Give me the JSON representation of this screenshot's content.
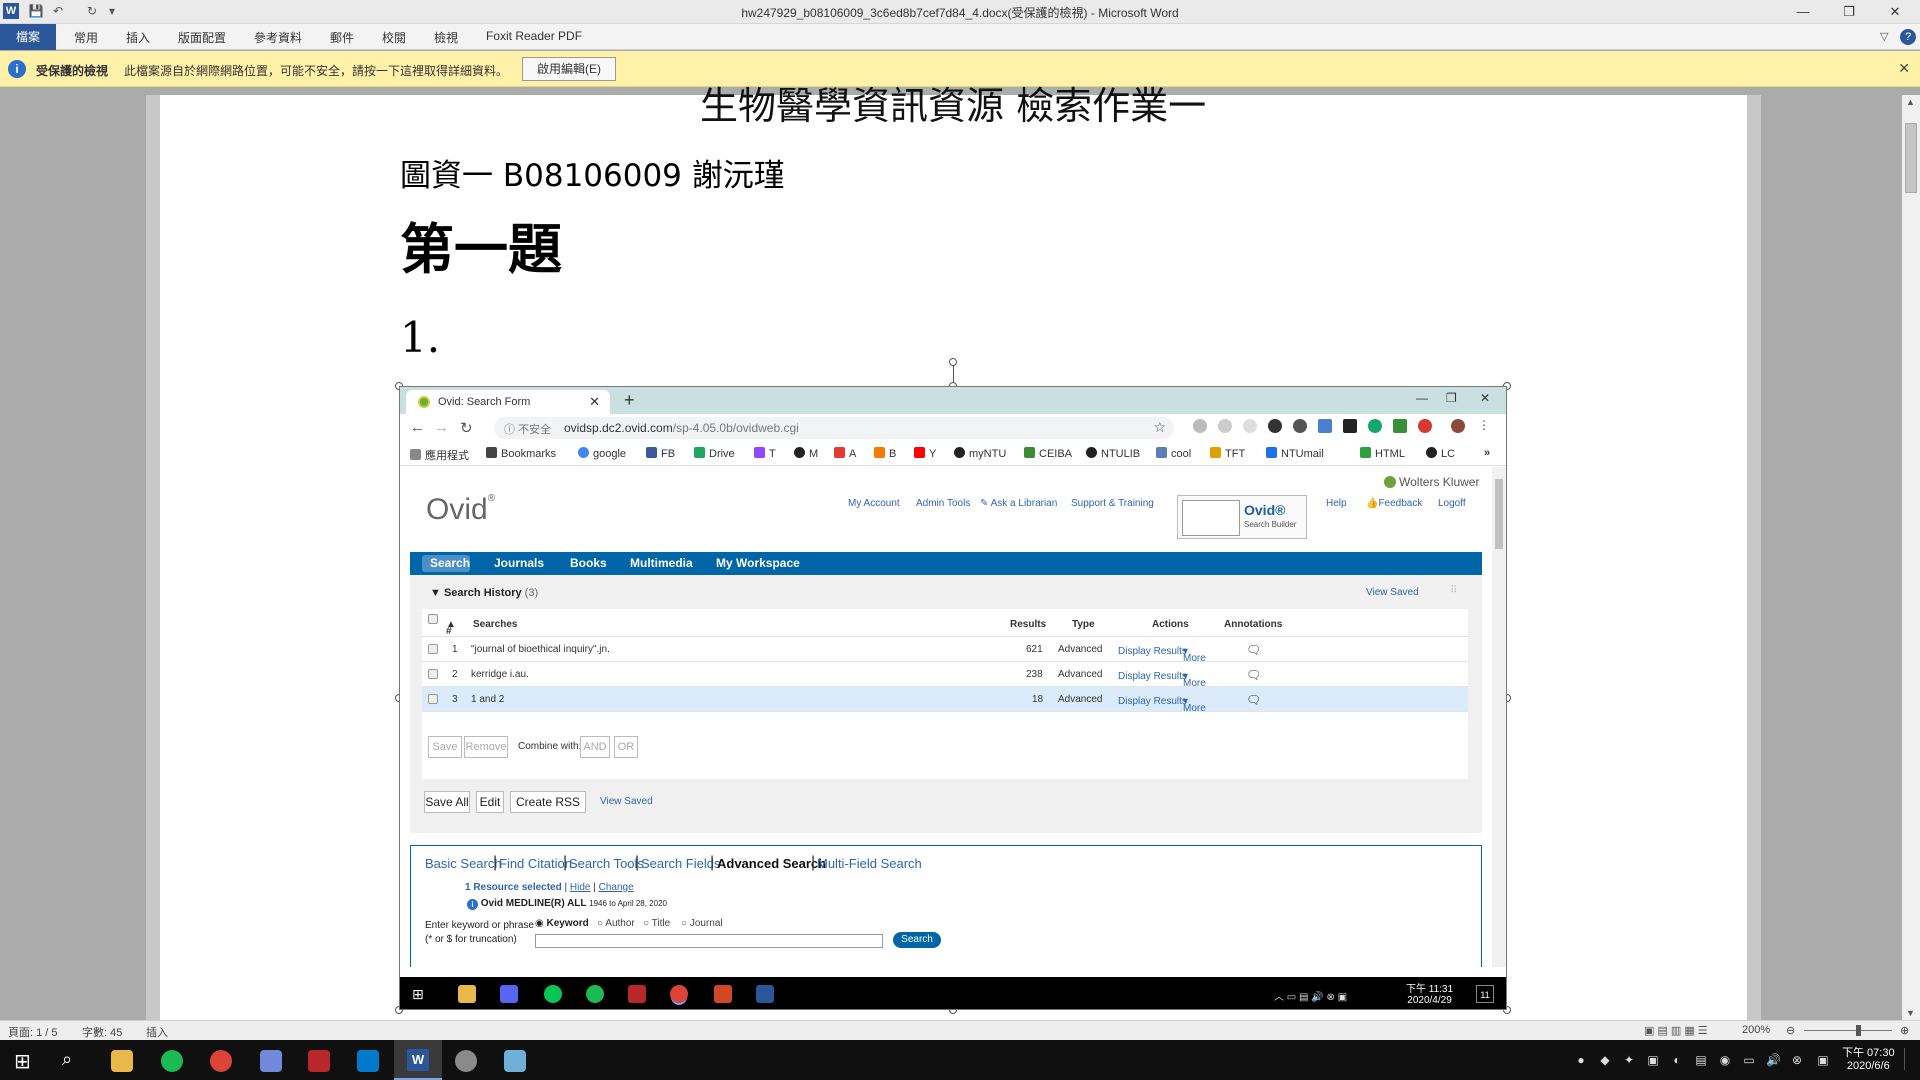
{
  "window": {
    "title": "hw247929_b08106009_3c6ed8b7cef7d84_4.docx(受保護的檢視) - Microsoft Word",
    "min_glyph": "—",
    "max_glyph": "❐",
    "close_glyph": "✕"
  },
  "ribbon": {
    "tabs": [
      "檔案",
      "常用",
      "插入",
      "版面配置",
      "參考資料",
      "郵件",
      "校閱",
      "檢視",
      "Foxit Reader PDF"
    ]
  },
  "protected_bar": {
    "title": "受保護的檢視",
    "message": "此檔案源自於網際網路位置，可能不安全，請按一下這裡取得詳細資料。",
    "button": "啟用編輯(E)"
  },
  "document": {
    "heading_top": "生物醫學資訊資源  檢索作業一",
    "author_line": "圖資一  B08106009 謝沅瑾",
    "section_title": "第一題",
    "item_number": "1."
  },
  "browser": {
    "tab_title": "Ovid: Search Form",
    "security": "不安全",
    "url_host": "ovidsp.dc2.ovid.com",
    "url_path": "/sp-4.05.0b/ovidweb.cgi",
    "bookmarks": [
      "應用程式",
      "Bookmarks",
      "google",
      "FB",
      "Drive",
      "T",
      "M",
      "A",
      "B",
      "Y",
      "myNTU",
      "CEIBA",
      "NTULIB",
      "cool",
      "TFT",
      "NTUmail",
      "HTML",
      "LC"
    ],
    "bookmark_colors": [
      "#888888",
      "#444444",
      "#4285f4",
      "#3b5998",
      "#1fa463",
      "#9146ff",
      "#222222",
      "#e53935",
      "#f57c00",
      "#ff0000",
      "#222222",
      "#3d8b37",
      "#222222",
      "#5b7fb5",
      "#e0a000",
      "#1a73e8",
      "#2e9e3e",
      "#222222"
    ]
  },
  "ovid": {
    "logo": "Ovid",
    "logo_reg": "®",
    "brand": "Wolters Kluwer",
    "top_links": [
      "My Account",
      "Admin Tools",
      "Ask a Librarian",
      "Support & Training",
      "Help",
      "Feedback",
      "Logoff"
    ],
    "search_builder_title": "Ovid®",
    "search_builder_sub": "Search Builder",
    "nav": [
      "Search",
      "Journals",
      "Books",
      "Multimedia",
      "My Workspace"
    ],
    "history_title": "Search History",
    "history_count": "(3)",
    "view_saved": "View Saved",
    "columns": [
      "#",
      "Searches",
      "Results",
      "Type",
      "Actions",
      "Annotations"
    ],
    "rows": [
      {
        "num": "1",
        "query": "\"journal of bioethical inquiry\".jn.",
        "results": "621",
        "type": "Advanced",
        "display": "Display Results",
        "more": "More"
      },
      {
        "num": "2",
        "query": "kerridge i.au.",
        "results": "238",
        "type": "Advanced",
        "display": "Display Results",
        "more": "More"
      },
      {
        "num": "3",
        "query": "1 and 2",
        "results": "18",
        "type": "Advanced",
        "display": "Display Results",
        "more": "More"
      }
    ],
    "history_buttons": {
      "save": "Save",
      "remove": "Remove",
      "combine": "Combine with:",
      "and": "AND",
      "or": "OR"
    },
    "bottom_buttons": {
      "save_all": "Save All",
      "edit": "Edit",
      "create_rss": "Create RSS",
      "view_saved": "View Saved"
    },
    "search_tabs": [
      "Basic Search",
      "Find Citation",
      "Search Tools",
      "Search Fields",
      "Advanced Search",
      "Multi-Field Search"
    ],
    "resource_selected": "1 Resource selected",
    "hide": "Hide",
    "change": "Change",
    "database": "Ovid MEDLINE(R) ALL",
    "database_range": "1946 to April 28, 2020",
    "keyword_label": "Enter keyword or phrase",
    "truncation_hint": "(* or $ for truncation)",
    "radio_options": [
      "Keyword",
      "Author",
      "Title",
      "Journal"
    ],
    "search_button": "Search"
  },
  "inner_taskbar": {
    "time": "下午 11:31",
    "date": "2020/4/29",
    "notif": "11"
  },
  "statusbar": {
    "page": "頁面: 1 / 5",
    "words": "字數: 45",
    "mode": "插入",
    "zoom": "200%"
  },
  "taskbar": {
    "time": "下午 07:30",
    "date": "2020/6/6"
  },
  "colors": {
    "word_blue": "#2b579a",
    "ovid_blue": "#0066a8",
    "link_blue": "#2e65b1",
    "protected_yellow": "#fff2a8"
  }
}
